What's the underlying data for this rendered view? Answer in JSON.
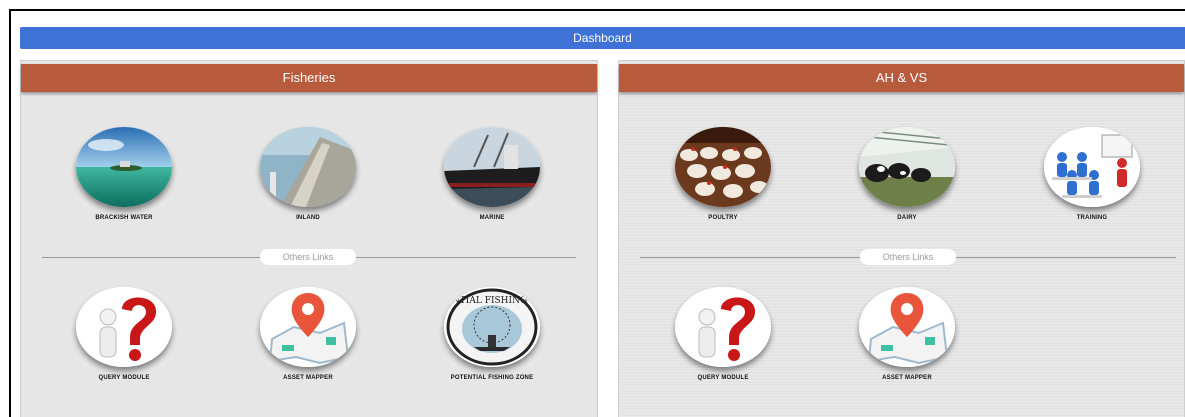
{
  "header": {
    "title": "Dashboard"
  },
  "colors": {
    "dashboard_bar": "#3e72d6",
    "panel_header": "#b85a3c"
  },
  "panels": [
    {
      "title": "Fisheries",
      "top_tiles": [
        {
          "label": "BRACKISH WATER",
          "icon": "island-water-icon"
        },
        {
          "label": "INLAND",
          "icon": "dam-icon"
        },
        {
          "label": "MARINE",
          "icon": "ship-icon"
        }
      ],
      "separator": "Others Links",
      "bottom_tiles": [
        {
          "label": "QUERY MODULE",
          "icon": "question-mark-icon"
        },
        {
          "label": "ASSET MAPPER",
          "icon": "map-pin-icon"
        },
        {
          "label": "POTENTIAL FISHING ZONE",
          "icon": "potential-fishing-zone-seal",
          "seal_text": "POTENTIAL FISHING ZONE"
        }
      ]
    },
    {
      "title": "AH & VS",
      "top_tiles": [
        {
          "label": "POULTRY",
          "icon": "chickens-icon"
        },
        {
          "label": "DAIRY",
          "icon": "cows-barn-icon"
        },
        {
          "label": "TRAINING",
          "icon": "training-class-icon"
        }
      ],
      "separator": "Others Links",
      "bottom_tiles": [
        {
          "label": "QUERY MODULE",
          "icon": "question-mark-icon"
        },
        {
          "label": "ASSET MAPPER",
          "icon": "map-pin-icon"
        }
      ]
    }
  ]
}
